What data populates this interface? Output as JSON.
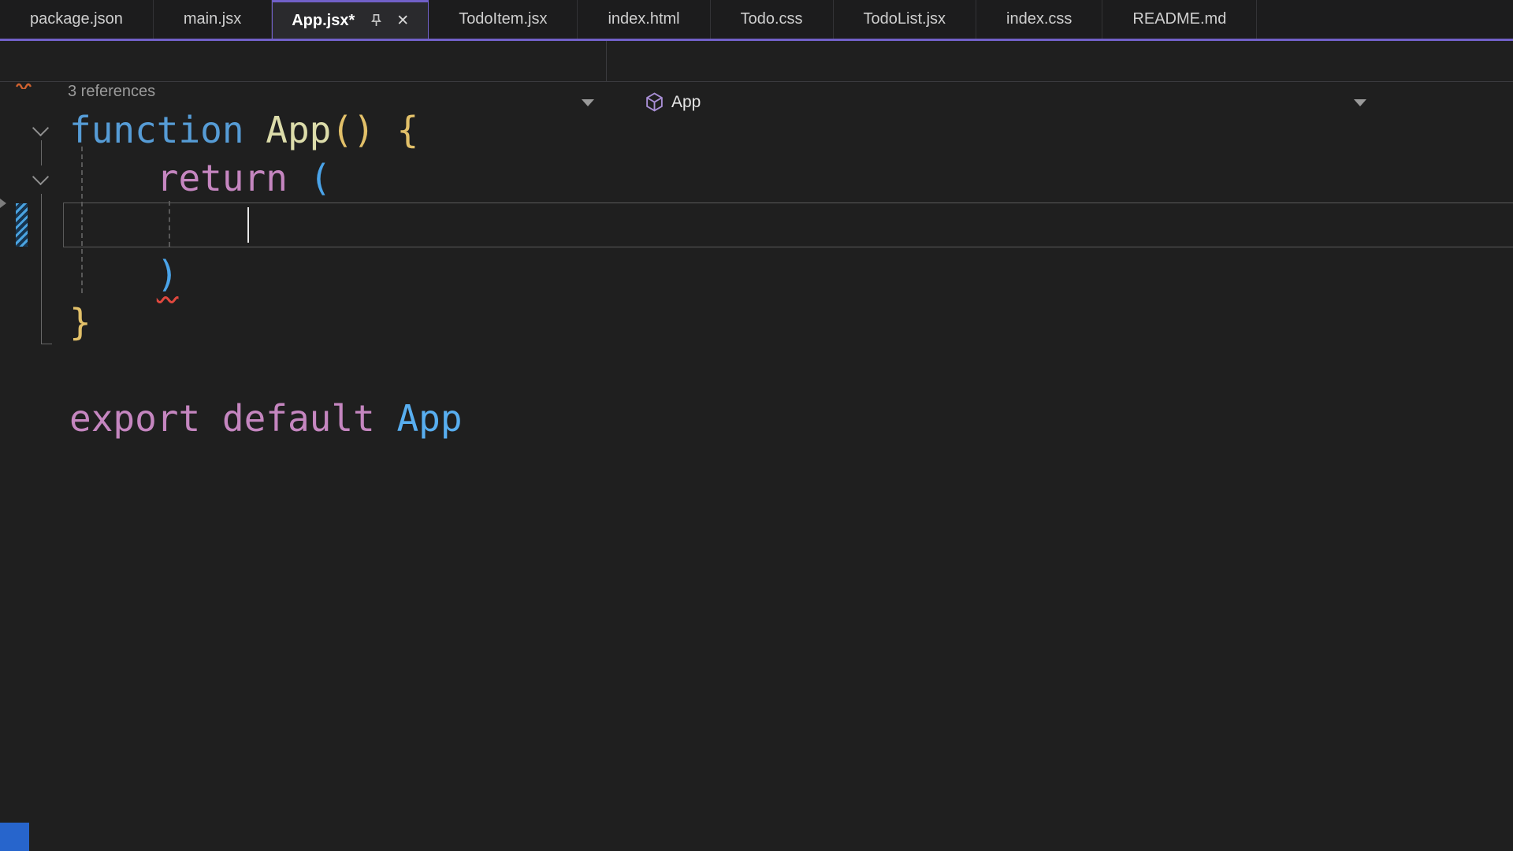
{
  "tab_bar": {
    "close_glyph": "✕",
    "tabs": [
      {
        "label": "package.json",
        "active": false
      },
      {
        "label": "main.jsx",
        "active": false
      },
      {
        "label": "App.jsx*",
        "active": true,
        "pinned": true
      },
      {
        "label": "TodoItem.jsx",
        "active": false
      },
      {
        "label": "index.html",
        "active": false
      },
      {
        "label": "Todo.css",
        "active": false
      },
      {
        "label": "TodoList.jsx",
        "active": false
      },
      {
        "label": "index.css",
        "active": false
      },
      {
        "label": "README.md",
        "active": false
      }
    ]
  },
  "navigation_bar": {
    "member_scope": "App"
  },
  "editor": {
    "codelens_label": "3 references",
    "lines": [
      {
        "tokens": [
          {
            "text": "function",
            "color": "keyword"
          },
          {
            "text": " ",
            "color": "plain"
          },
          {
            "text": "App",
            "color": "function"
          },
          {
            "text": "()",
            "color": "gold"
          },
          {
            "text": " ",
            "color": "plain"
          },
          {
            "text": "{",
            "color": "gold"
          }
        ]
      },
      {
        "tokens": [
          {
            "text": "    ",
            "color": "plain"
          },
          {
            "text": "return",
            "color": "control"
          },
          {
            "text": " ",
            "color": "plain"
          },
          {
            "text": "(",
            "color": "paren"
          }
        ]
      },
      {
        "tokens": [],
        "current": true
      },
      {
        "tokens": [
          {
            "text": "    ",
            "color": "plain"
          },
          {
            "text": ")",
            "color": "paren",
            "error": true
          }
        ]
      },
      {
        "tokens": [
          {
            "text": "}",
            "color": "gold"
          }
        ]
      },
      {
        "tokens": []
      },
      {
        "tokens": [
          {
            "text": "export",
            "color": "control"
          },
          {
            "text": " ",
            "color": "plain"
          },
          {
            "text": "default",
            "color": "control"
          },
          {
            "text": " ",
            "color": "plain"
          },
          {
            "text": "App",
            "color": "variable"
          }
        ]
      }
    ]
  },
  "colors": {
    "background": "#1f1f1f",
    "accent_purple": "#7160c8",
    "keyword_blue": "#569cd6",
    "function_yellow": "#dcdcaa",
    "brace_gold": "#e2c069",
    "control_pink": "#c586c0",
    "bracket_blue": "#4aa3e8",
    "identifier_blue": "#58aef0",
    "error_red": "#e0483e",
    "change_marker_blue": "#4aa3e0"
  }
}
